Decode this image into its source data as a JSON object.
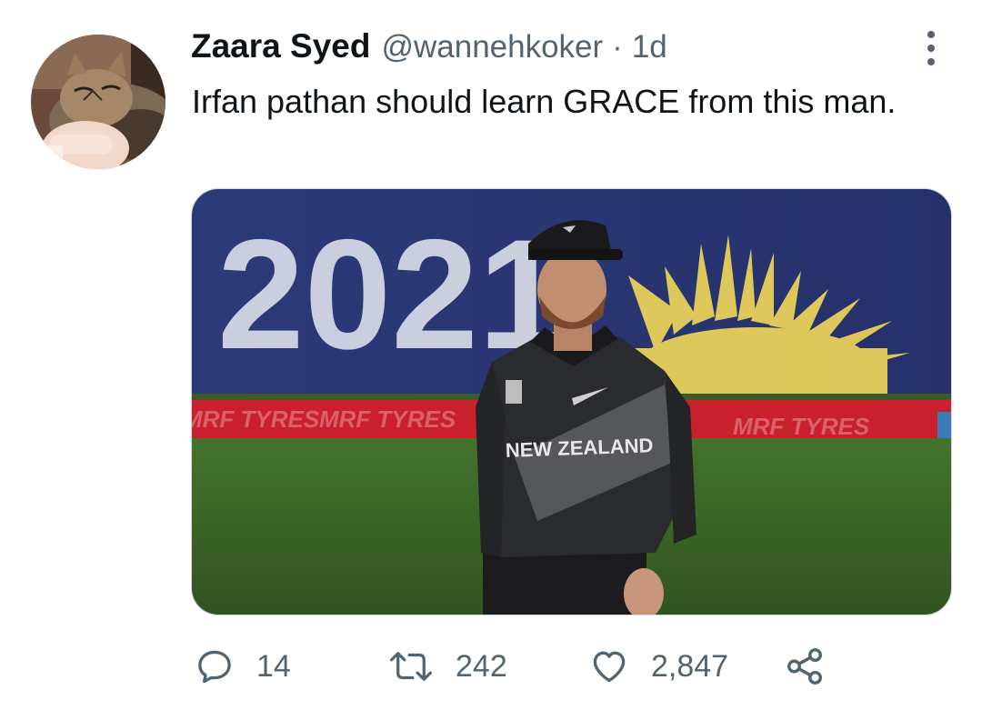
{
  "tweet": {
    "author": {
      "display_name": "Zaara Syed",
      "handle": "@wannehkoker",
      "separator": "·",
      "time": "1d"
    },
    "text": "Irfan pathan should learn GRACE from this man.",
    "media": {
      "banner_year": "2021",
      "board_text": "MRF TYRES",
      "jersey_text": "NEW ZEALAND"
    },
    "actions": {
      "reply_count": "14",
      "retweet_count": "242",
      "like_count": "2,847"
    }
  },
  "icons": {
    "more": "more-icon",
    "reply": "reply-icon",
    "retweet": "retweet-icon",
    "like": "like-icon",
    "share": "share-icon"
  },
  "colors": {
    "text_primary": "#0f1419",
    "text_secondary": "#536471",
    "banner_blue": "#2e3a78",
    "board_red": "#c8202c",
    "outfield_green": "#3f6b2a"
  }
}
